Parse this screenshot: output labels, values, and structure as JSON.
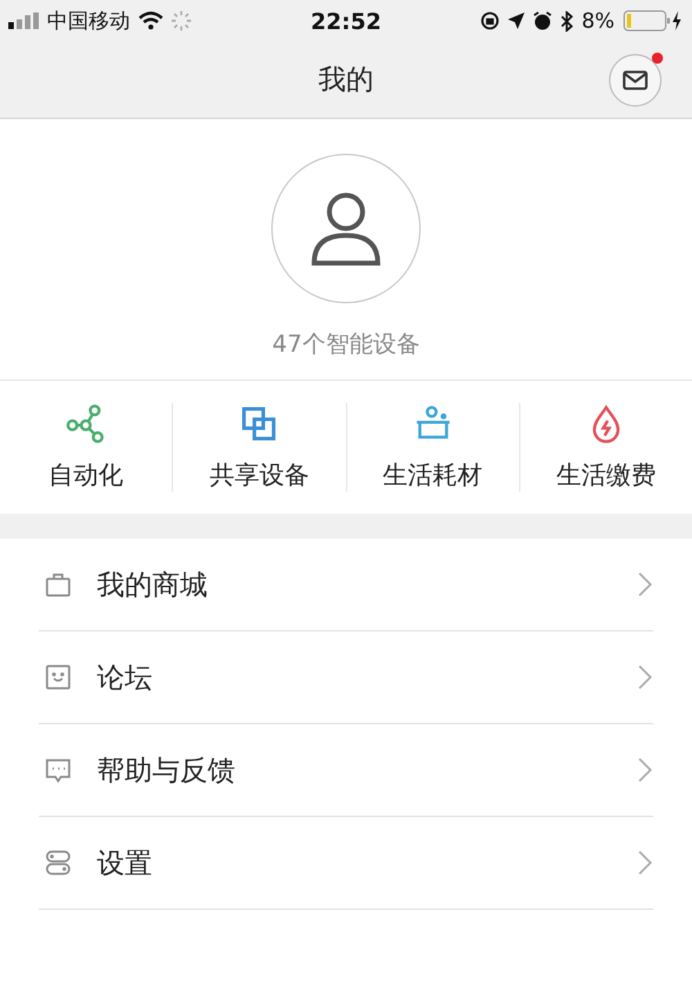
{
  "status_bar": {
    "carrier": "中国移动",
    "time": "22:52",
    "battery": "8%"
  },
  "nav": {
    "title": "我的",
    "mail_unread": true
  },
  "profile": {
    "device_count": "47个智能设备"
  },
  "shortcuts": [
    {
      "kind": "automation",
      "label": "自动化"
    },
    {
      "kind": "share",
      "label": "共享设备"
    },
    {
      "kind": "supplies",
      "label": "生活耗材"
    },
    {
      "kind": "utility",
      "label": "生活缴费"
    }
  ],
  "menu": [
    {
      "kind": "store",
      "label": "我的商城"
    },
    {
      "kind": "forum",
      "label": "论坛"
    },
    {
      "kind": "help",
      "label": "帮助与反馈"
    },
    {
      "kind": "settings",
      "label": "设置"
    }
  ]
}
